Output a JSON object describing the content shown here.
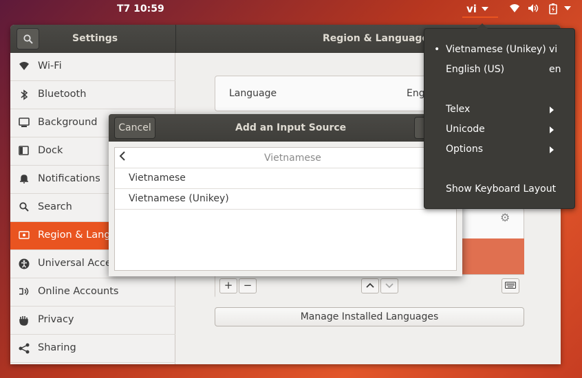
{
  "topbar": {
    "clock": "T7 10:59",
    "ime_label": "vi",
    "icons": [
      "wifi-icon",
      "volume-icon",
      "battery-icon",
      "system-menu-icon"
    ]
  },
  "window": {
    "sidebar_title": "Settings",
    "page_title": "Region & Language",
    "sidebar": {
      "items": [
        {
          "label": "Wi-Fi",
          "icon": "wifi-icon"
        },
        {
          "label": "Bluetooth",
          "icon": "bluetooth-icon"
        },
        {
          "label": "Background",
          "icon": "background-icon"
        },
        {
          "label": "Dock",
          "icon": "dock-icon"
        },
        {
          "label": "Notifications",
          "icon": "bell-icon"
        },
        {
          "label": "Search",
          "icon": "search-icon"
        },
        {
          "label": "Region & Language",
          "icon": "flag-icon",
          "active": true
        },
        {
          "label": "Universal Access",
          "icon": "accessibility-icon"
        },
        {
          "label": "Online Accounts",
          "icon": "online-accounts-icon"
        },
        {
          "label": "Privacy",
          "icon": "hand-icon"
        },
        {
          "label": "Sharing",
          "icon": "share-icon"
        }
      ]
    },
    "main": {
      "language_label": "Language",
      "language_value": "Eng",
      "manage_button": "Manage Installed Languages"
    }
  },
  "dialog": {
    "cancel_label": "Cancel",
    "title": "Add an Input Source",
    "header": "Vietnamese",
    "rows": [
      "Vietnamese",
      "Vietnamese (Unikey)"
    ]
  },
  "menu": {
    "sources": [
      {
        "label": "Vietnamese (Unikey)",
        "code": "vi",
        "selected": true
      },
      {
        "label": "English (US)",
        "code": "en",
        "selected": false
      }
    ],
    "submenus": [
      "Telex",
      "Unicode",
      "Options"
    ],
    "show_layout": "Show Keyboard Layout"
  },
  "colors": {
    "accent": "#e95420"
  }
}
